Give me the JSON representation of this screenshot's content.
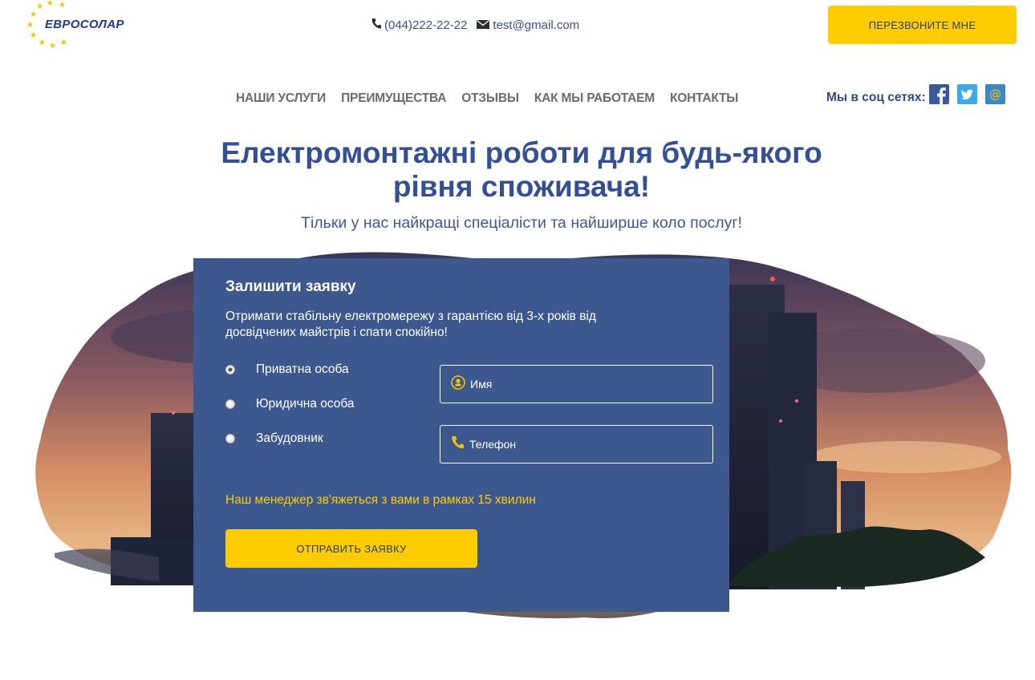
{
  "header": {
    "logo_text": "ЕВРОСОЛАР",
    "phone": "(044)222-22-22",
    "email": "test@gmail.com",
    "callback_label": "ПЕРЕЗВОНИТЕ МНЕ",
    "phone_icon": "phone-icon",
    "email_icon": "envelope-icon"
  },
  "nav": {
    "items": [
      {
        "label": "НАШИ УСЛУГИ"
      },
      {
        "label": "ПРЕИМУЩЕСТВА"
      },
      {
        "label": "ОТЗЫВЫ"
      },
      {
        "label": "КАК МЫ РАБОТАЕМ"
      },
      {
        "label": "КОНТАКТЫ"
      }
    ]
  },
  "social": {
    "label": "Мы в соц сетях:",
    "icons": [
      "facebook-icon",
      "twitter-icon",
      "email-at-icon"
    ]
  },
  "hero": {
    "title_line1": "Електромонтажні роботи для будь-якого",
    "title_line2": "рівня споживача!",
    "subtitle": "Тільки у нас найкращі спеціалісти та найширше коло послуг!"
  },
  "form": {
    "title": "Залишити заявку",
    "description": "Отримати стабільну електромережу з гарантією від 3-х років від досвідчених майстрів і спати спокійно!",
    "radio_options": [
      {
        "label": "Приватна особа",
        "checked": true
      },
      {
        "label": "Юридична особа",
        "checked": false
      },
      {
        "label": "Забудовник",
        "checked": false
      }
    ],
    "name_placeholder": "Имя",
    "phone_placeholder": "Телефон",
    "manager_note": "Наш менеджер зв'яжеться з вами в рамках 15 хвилин",
    "submit_label": "ОТПРАВИТЬ ЗАЯВКУ"
  },
  "colors": {
    "accent_yellow": "#ffcc00",
    "brand_blue": "#354f94",
    "panel_blue": "#3d588f",
    "nav_gray": "#6b6b6b"
  }
}
